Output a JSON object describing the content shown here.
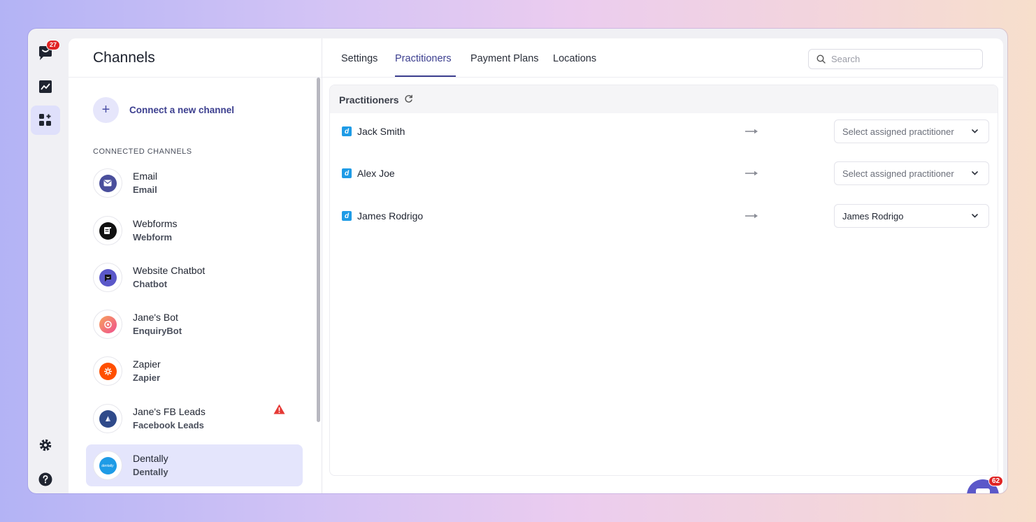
{
  "rail": {
    "notification_count": "27",
    "items": [
      "logo-icon",
      "analytics-icon",
      "apps-icon",
      "settings-icon",
      "help-icon"
    ]
  },
  "channels": {
    "title": "Channels",
    "connect_label": "Connect a new channel",
    "section_label": "CONNECTED CHANNELS",
    "items": [
      {
        "name": "Email",
        "type": "Email",
        "icon": "email-icon",
        "color": "#4a4f9c"
      },
      {
        "name": "Webforms",
        "type": "Webform",
        "icon": "webform-icon",
        "color": "#111111"
      },
      {
        "name": "Website Chatbot",
        "type": "Chatbot",
        "icon": "chatbot-icon",
        "color": "#5b58c9"
      },
      {
        "name": "Jane's Bot",
        "type": "EnquiryBot",
        "icon": "enquirybot-icon",
        "color": "#f06a6a"
      },
      {
        "name": "Zapier",
        "type": "Zapier",
        "icon": "zapier-icon",
        "color": "#ff4f00"
      },
      {
        "name": "Jane's FB Leads",
        "type": "Facebook Leads",
        "icon": "facebook-leads-icon",
        "color": "#2f4a8a",
        "warning": true
      },
      {
        "name": "Dentally",
        "type": "Dentally",
        "icon": "dentally-icon",
        "color": "#1e9be6",
        "selected": true
      }
    ]
  },
  "tabs": [
    {
      "label": "Settings",
      "active": false
    },
    {
      "label": "Practitioners",
      "active": true
    },
    {
      "label": "Payment Plans",
      "active": false
    },
    {
      "label": "Locations",
      "active": false
    }
  ],
  "search": {
    "placeholder": "Search",
    "value": ""
  },
  "practitioners": {
    "title": "Practitioners",
    "rows": [
      {
        "name": "Jack Smith",
        "assigned": "Select assigned practitioner",
        "filled": false
      },
      {
        "name": "Alex Joe",
        "assigned": "Select assigned practitioner",
        "filled": false
      },
      {
        "name": "James Rodrigo",
        "assigned": "James Rodrigo",
        "filled": true
      }
    ]
  },
  "chat_widget": {
    "badge": "62"
  },
  "colors": {
    "accent": "#3c3f8f",
    "selected_bg": "#e4e5fc",
    "badge": "#e02424",
    "dentally": "#1e9be6"
  }
}
